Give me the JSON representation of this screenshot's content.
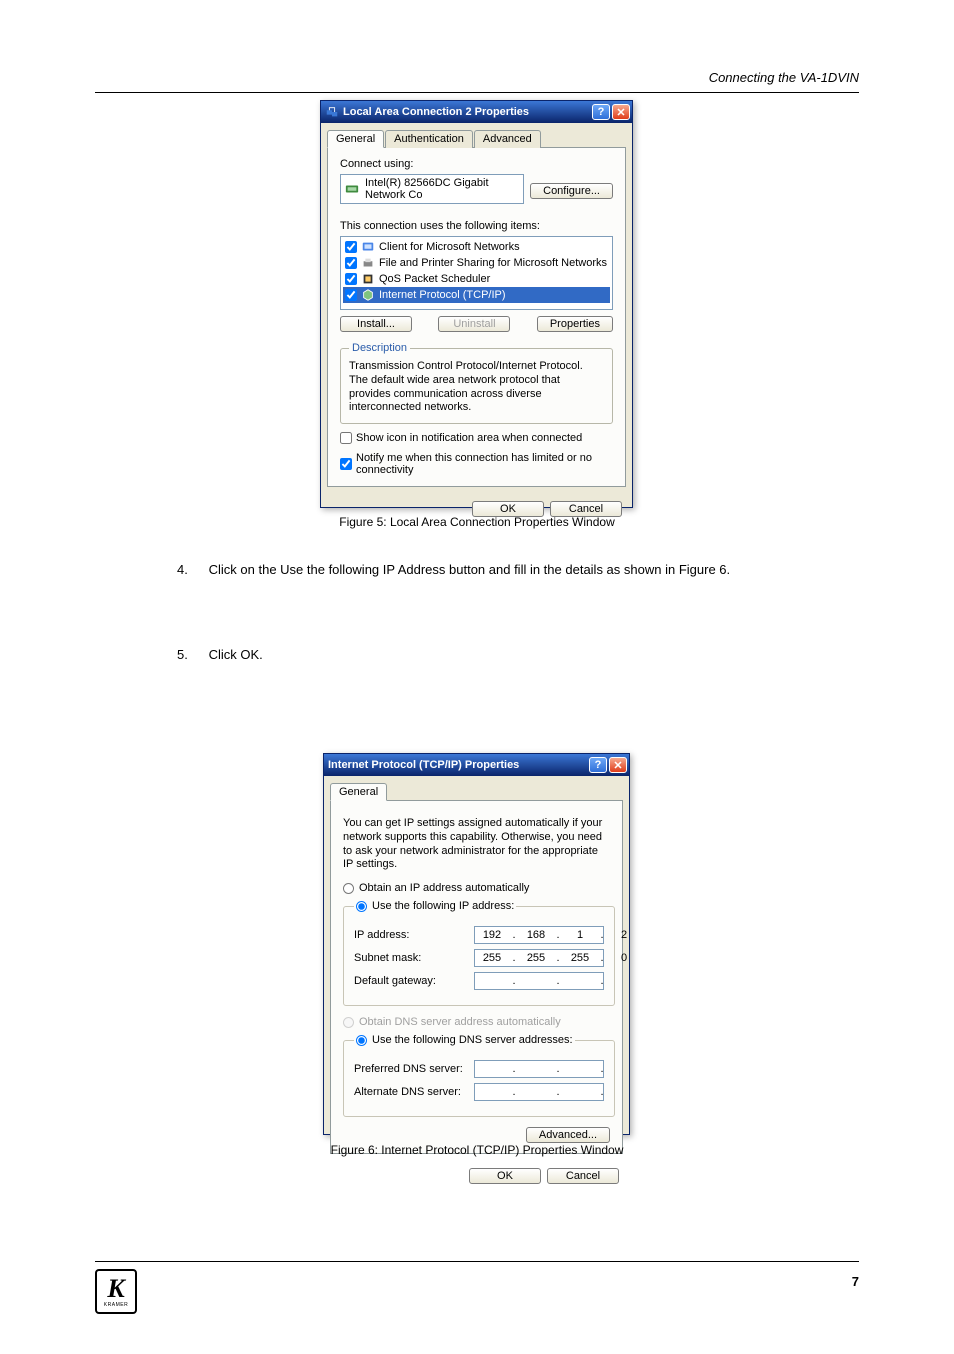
{
  "page": {
    "header_text": "Connecting the VA-1DVIN",
    "page_number": "7",
    "step4_num": "4.",
    "step4_text": "Click on the Use the following IP Address button and fill in the details as shown in Figure 6.",
    "step5_num": "5.",
    "step5_text": "Click OK.",
    "logo_k": "K",
    "logo_brand": "KRAMER"
  },
  "dialog1": {
    "title": "Local Area Connection 2 Properties",
    "tabs": [
      "General",
      "Authentication",
      "Advanced"
    ],
    "connect_label": "Connect using:",
    "adapter": "Intel(R) 82566DC Gigabit Network Co",
    "configure_btn": "Configure...",
    "items_label": "This connection uses the following items:",
    "items": [
      {
        "label": "Client for Microsoft Networks",
        "checked": true,
        "selected": false
      },
      {
        "label": "File and Printer Sharing for Microsoft Networks",
        "checked": true,
        "selected": false
      },
      {
        "label": "QoS Packet Scheduler",
        "checked": true,
        "selected": false
      },
      {
        "label": "Internet Protocol (TCP/IP)",
        "checked": true,
        "selected": true
      }
    ],
    "install_btn": "Install...",
    "uninstall_btn": "Uninstall",
    "properties_btn": "Properties",
    "desc_legend": "Description",
    "desc_text": "Transmission Control Protocol/Internet Protocol. The default wide area network protocol that provides communication across diverse interconnected networks.",
    "show_icon": "Show icon in notification area when connected",
    "notify_me": "Notify me when this connection has limited or no connectivity",
    "show_icon_checked": false,
    "notify_me_checked": true,
    "ok_btn": "OK",
    "cancel_btn": "Cancel",
    "caption": "Figure 5: Local Area Connection Properties Window"
  },
  "dialog2": {
    "title": "Internet Protocol (TCP/IP) Properties",
    "tabs": [
      "General"
    ],
    "intro": "You can get IP settings assigned automatically if your network supports this capability. Otherwise, you need to ask your network administrator for the appropriate IP settings.",
    "radio_auto_ip": "Obtain an IP address automatically",
    "radio_use_ip": "Use the following IP address:",
    "ip_label": "IP address:",
    "ip_value": [
      "192",
      "168",
      "1",
      "2"
    ],
    "subnet_label": "Subnet mask:",
    "subnet_value": [
      "255",
      "255",
      "255",
      "0"
    ],
    "gateway_label": "Default gateway:",
    "gateway_value": [
      "",
      "",
      "",
      ""
    ],
    "radio_auto_dns": "Obtain DNS server address automatically",
    "radio_use_dns": "Use the following DNS server addresses:",
    "pref_dns_label": "Preferred DNS server:",
    "pref_dns_value": [
      "",
      "",
      "",
      ""
    ],
    "alt_dns_label": "Alternate DNS server:",
    "alt_dns_value": [
      "",
      "",
      "",
      ""
    ],
    "advanced_btn": "Advanced...",
    "ok_btn": "OK",
    "cancel_btn": "Cancel",
    "caption": "Figure 6: Internet Protocol (TCP/IP) Properties Window"
  }
}
